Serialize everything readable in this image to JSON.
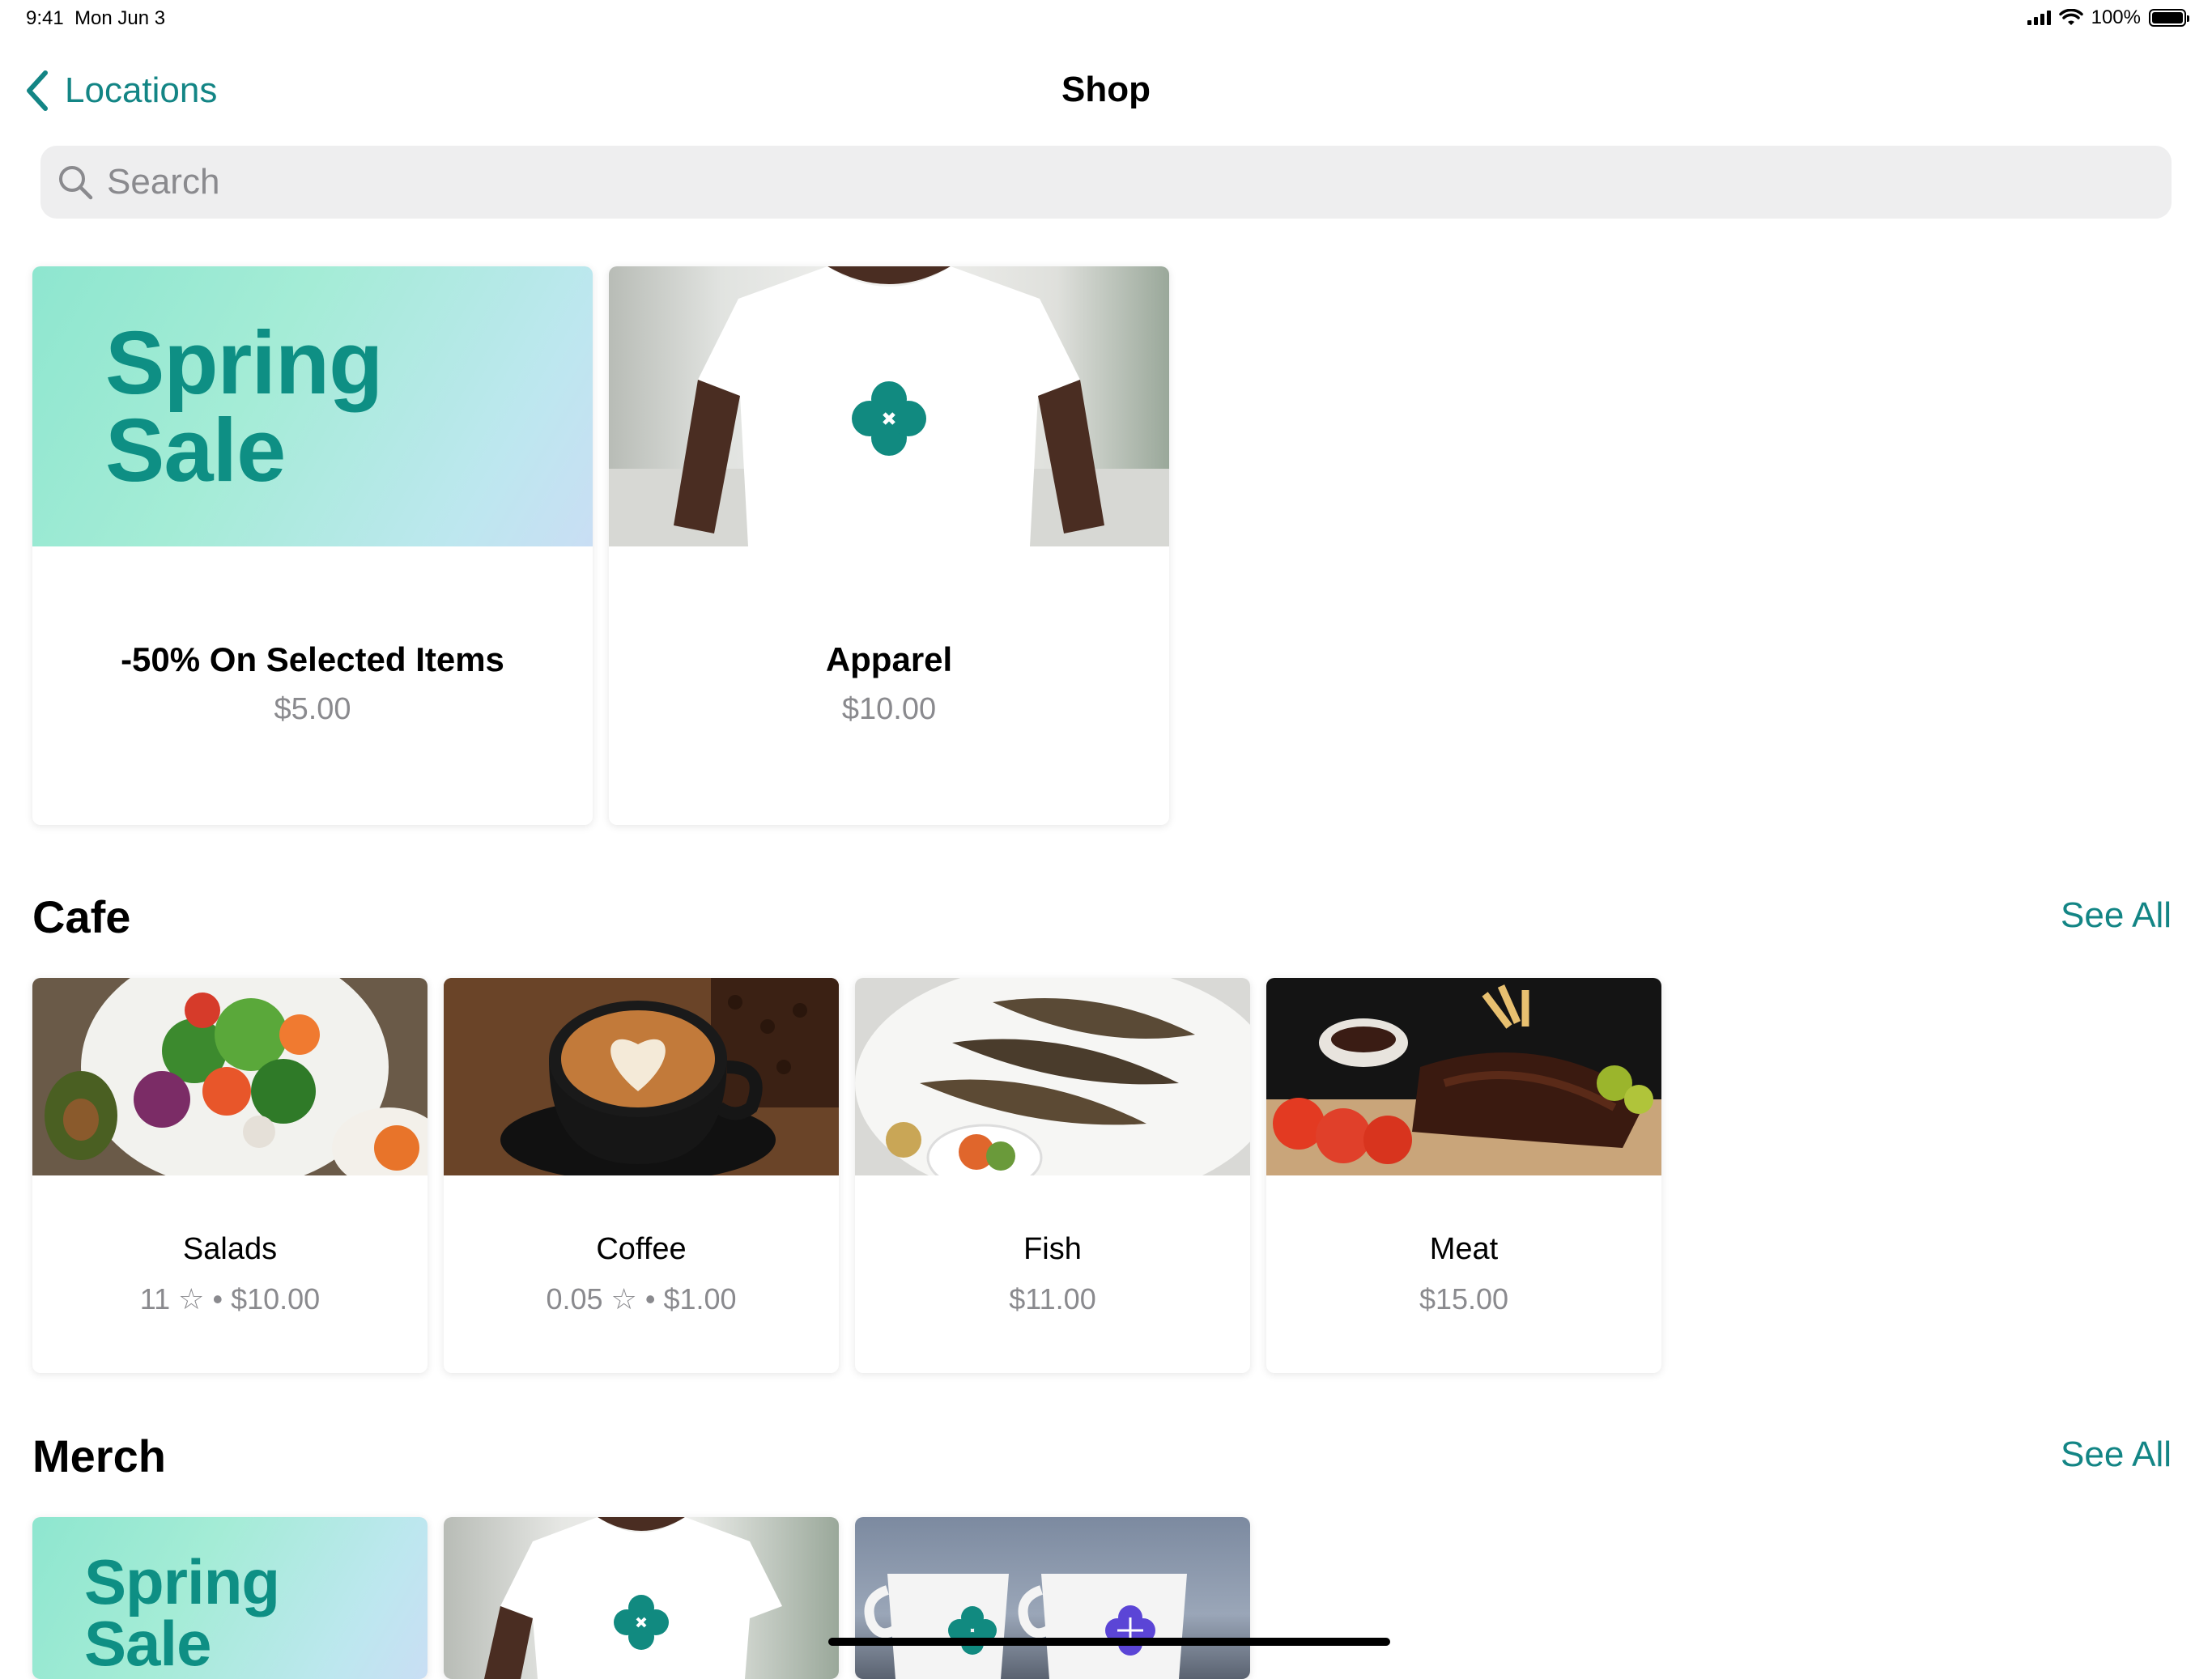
{
  "status_bar": {
    "time": "9:41",
    "date": "Mon Jun 3",
    "battery": "100%"
  },
  "nav": {
    "back_label": "Locations",
    "title": "Shop"
  },
  "search": {
    "placeholder": "Search"
  },
  "featured": [
    {
      "image_text_line1": "Spring",
      "image_text_line2": "Sale",
      "title": "-50% On Selected Items",
      "price": "$5.00"
    },
    {
      "title": "Apparel",
      "price": "$10.00"
    }
  ],
  "cafe": {
    "title": "Cafe",
    "see_all": "See All",
    "items": [
      {
        "title": "Salads",
        "rating": "11",
        "price": "$10.00"
      },
      {
        "title": "Coffee",
        "rating": "0.05",
        "price": "$1.00"
      },
      {
        "title": "Fish",
        "price": "$11.00"
      },
      {
        "title": "Meat",
        "price": "$15.00"
      }
    ]
  },
  "merch": {
    "title": "Merch",
    "see_all": "See All",
    "items": [
      {
        "image_text_line1": "Spring",
        "image_text_line2": "Sale"
      },
      {},
      {}
    ]
  },
  "colors": {
    "accent": "#138585",
    "brand_teal": "#0e8f84",
    "secondary_text": "#8a8a8e",
    "search_bg": "#eeeeef"
  },
  "separator": "•"
}
